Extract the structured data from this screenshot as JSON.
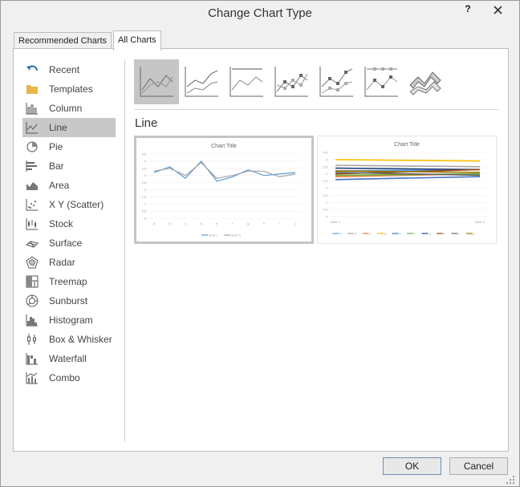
{
  "dialog": {
    "title": "Change Chart Type",
    "help": "?"
  },
  "tabs": [
    {
      "label": "Recommended Charts"
    },
    {
      "label": "All Charts"
    }
  ],
  "sidebar": {
    "items": [
      {
        "label": "Recent",
        "icon": "undo-arrow-icon"
      },
      {
        "label": "Templates",
        "icon": "folder-icon"
      },
      {
        "label": "Column",
        "icon": "column-chart-icon"
      },
      {
        "label": "Line",
        "icon": "line-chart-icon",
        "selected": true
      },
      {
        "label": "Pie",
        "icon": "pie-chart-icon"
      },
      {
        "label": "Bar",
        "icon": "bar-chart-icon"
      },
      {
        "label": "Area",
        "icon": "area-chart-icon"
      },
      {
        "label": "X Y (Scatter)",
        "icon": "scatter-chart-icon"
      },
      {
        "label": "Stock",
        "icon": "stock-chart-icon"
      },
      {
        "label": "Surface",
        "icon": "surface-chart-icon"
      },
      {
        "label": "Radar",
        "icon": "radar-chart-icon"
      },
      {
        "label": "Treemap",
        "icon": "treemap-chart-icon"
      },
      {
        "label": "Sunburst",
        "icon": "sunburst-chart-icon"
      },
      {
        "label": "Histogram",
        "icon": "histogram-chart-icon"
      },
      {
        "label": "Box & Whisker",
        "icon": "box-whisker-chart-icon"
      },
      {
        "label": "Waterfall",
        "icon": "waterfall-chart-icon"
      },
      {
        "label": "Combo",
        "icon": "combo-chart-icon"
      }
    ]
  },
  "main": {
    "section_title": "Line",
    "subtypes": [
      {
        "name": "line",
        "selected": true
      },
      {
        "name": "stacked-line"
      },
      {
        "name": "100-stacked-line"
      },
      {
        "name": "line-with-markers"
      },
      {
        "name": "stacked-line-with-markers"
      },
      {
        "name": "100-stacked-line-with-markers"
      },
      {
        "name": "3d-line"
      }
    ],
    "previews": [
      {
        "title": "Chart Title",
        "y_ticks": [
          "4,5",
          "4",
          "3,5",
          "3",
          "2,5",
          "2",
          "1,5",
          "1",
          "0,5",
          "0"
        ],
        "x_ticks": [
          "a",
          "b",
          "c",
          "d",
          "e",
          "f",
          "g",
          "h",
          "i",
          "j"
        ],
        "legend": [
          "sectr 1",
          "sectr 2"
        ],
        "series_colors": [
          "#5b9bd5",
          "#a5a5a5"
        ],
        "series": [
          {
            "values": [
              3.2,
              3.6,
              2.8,
              4.0,
              2.6,
              2.9,
              3.4,
              3.0,
              3.1,
              3.2
            ]
          },
          {
            "values": [
              3.3,
              3.5,
              3.0,
              3.9,
              2.8,
              3.0,
              3.3,
              3.3,
              2.9,
              3.1
            ]
          }
        ]
      },
      {
        "title": "Chart Title",
        "y_ticks": [
          "4,5",
          "4",
          "3,5",
          "3",
          "2,5",
          "2",
          "1,5",
          "1",
          "0,5",
          "0"
        ],
        "x_ticks": [
          "sectr 1",
          "sectr 2"
        ],
        "legend": [
          "a",
          "b",
          "c",
          "d",
          "e",
          "f",
          "g",
          "h",
          "i",
          "j"
        ],
        "series_colors": [
          "#5b9bd5",
          "#a5a5a5",
          "#ed7d31",
          "#ffc000",
          "#4472c4",
          "#70ad47",
          "#264478",
          "#9e480e",
          "#636363",
          "#997300"
        ],
        "series": [
          {
            "values": [
              3.2,
              3.3
            ]
          },
          {
            "values": [
              3.6,
              3.5
            ]
          },
          {
            "values": [
              2.8,
              3.0
            ]
          },
          {
            "values": [
              4.0,
              3.9
            ]
          },
          {
            "values": [
              2.6,
              2.8
            ]
          },
          {
            "values": [
              2.9,
              3.0
            ]
          },
          {
            "values": [
              3.4,
              3.3
            ]
          },
          {
            "values": [
              3.0,
              3.3
            ]
          },
          {
            "values": [
              3.1,
              2.9
            ]
          },
          {
            "values": [
              3.2,
              3.1
            ]
          }
        ]
      }
    ]
  },
  "footer": {
    "ok_label": "OK",
    "cancel_label": "Cancel"
  }
}
